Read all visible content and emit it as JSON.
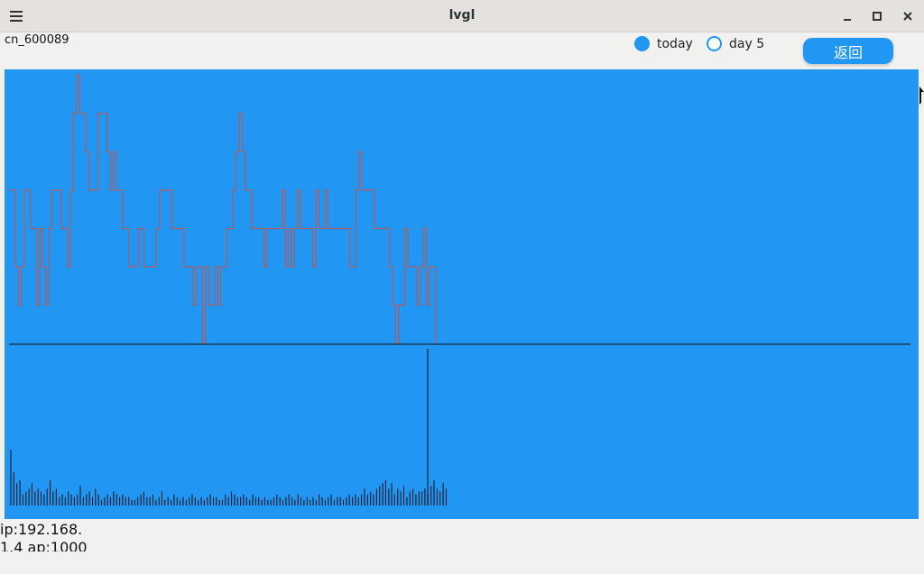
{
  "window": {
    "title": "lvgl"
  },
  "header": {
    "stock_code": "cn_600089",
    "radio_options": [
      {
        "label": "today",
        "checked": true
      },
      {
        "label": "day 5",
        "checked": false
      }
    ],
    "back_label": "返回"
  },
  "footer": {
    "ip_text": "ip:192.168.",
    "ap_text": "1.4 ap:1000"
  },
  "colors": {
    "panel": "#2196f3",
    "price_line": "#b55b5b",
    "volume_bar": "#101010",
    "axis_line": "#101010"
  },
  "chart_data": {
    "type": "line",
    "note": "upper pane: price level series; lower pane: volume bars",
    "price": [
      4,
      4,
      2,
      1,
      2,
      4,
      4,
      3,
      3,
      1,
      3,
      2,
      1,
      3,
      4,
      4,
      4,
      3,
      3,
      2,
      4,
      6,
      7,
      6,
      6,
      5,
      4,
      4,
      4,
      6,
      6,
      6,
      5,
      4,
      5,
      4,
      4,
      3,
      3,
      2,
      2,
      2,
      3,
      3,
      2,
      2,
      2,
      2,
      3,
      4,
      4,
      4,
      4,
      3,
      3,
      3,
      3,
      2,
      2,
      2,
      1,
      2,
      2,
      0,
      2,
      1,
      1,
      2,
      1,
      2,
      2,
      3,
      3,
      4,
      5,
      6,
      5,
      4,
      4,
      3,
      3,
      3,
      3,
      2,
      3,
      3,
      3,
      3,
      3,
      4,
      2,
      3,
      2,
      3,
      4,
      3,
      3,
      3,
      3,
      2,
      4,
      3,
      3,
      4,
      3,
      3,
      3,
      3,
      3,
      3,
      3,
      2,
      2,
      4,
      5,
      4,
      4,
      4,
      4,
      3,
      3,
      3,
      3,
      3,
      2,
      1,
      0,
      1,
      1,
      3,
      2,
      2,
      2,
      1,
      2,
      3,
      1,
      2,
      2,
      0
    ],
    "volume": [
      20,
      12,
      8,
      9,
      4,
      5,
      6,
      8,
      5,
      6,
      5,
      4,
      6,
      9,
      5,
      6,
      3,
      4,
      3,
      5,
      4,
      3,
      4,
      7,
      3,
      4,
      5,
      3,
      6,
      4,
      2,
      3,
      4,
      3,
      5,
      4,
      3,
      4,
      3,
      3,
      2,
      2,
      3,
      4,
      5,
      3,
      3,
      4,
      2,
      3,
      5,
      2,
      3,
      2,
      4,
      3,
      2,
      3,
      2,
      3,
      4,
      3,
      2,
      3,
      2,
      3,
      4,
      3,
      3,
      2,
      2,
      4,
      3,
      5,
      4,
      3,
      3,
      4,
      3,
      2,
      4,
      3,
      3,
      2,
      3,
      2,
      2,
      3,
      4,
      3,
      2,
      3,
      4,
      3,
      2,
      4,
      3,
      2,
      3,
      2,
      3,
      2,
      4,
      3,
      2,
      3,
      4,
      2,
      3,
      3,
      2,
      3,
      4,
      3,
      4,
      3,
      4,
      6,
      4,
      5,
      4,
      6,
      7,
      8,
      9,
      6,
      8,
      4,
      6,
      5,
      7,
      3,
      5,
      6,
      4,
      5,
      5,
      6,
      4,
      7,
      9,
      6,
      5,
      8,
      6
    ]
  }
}
